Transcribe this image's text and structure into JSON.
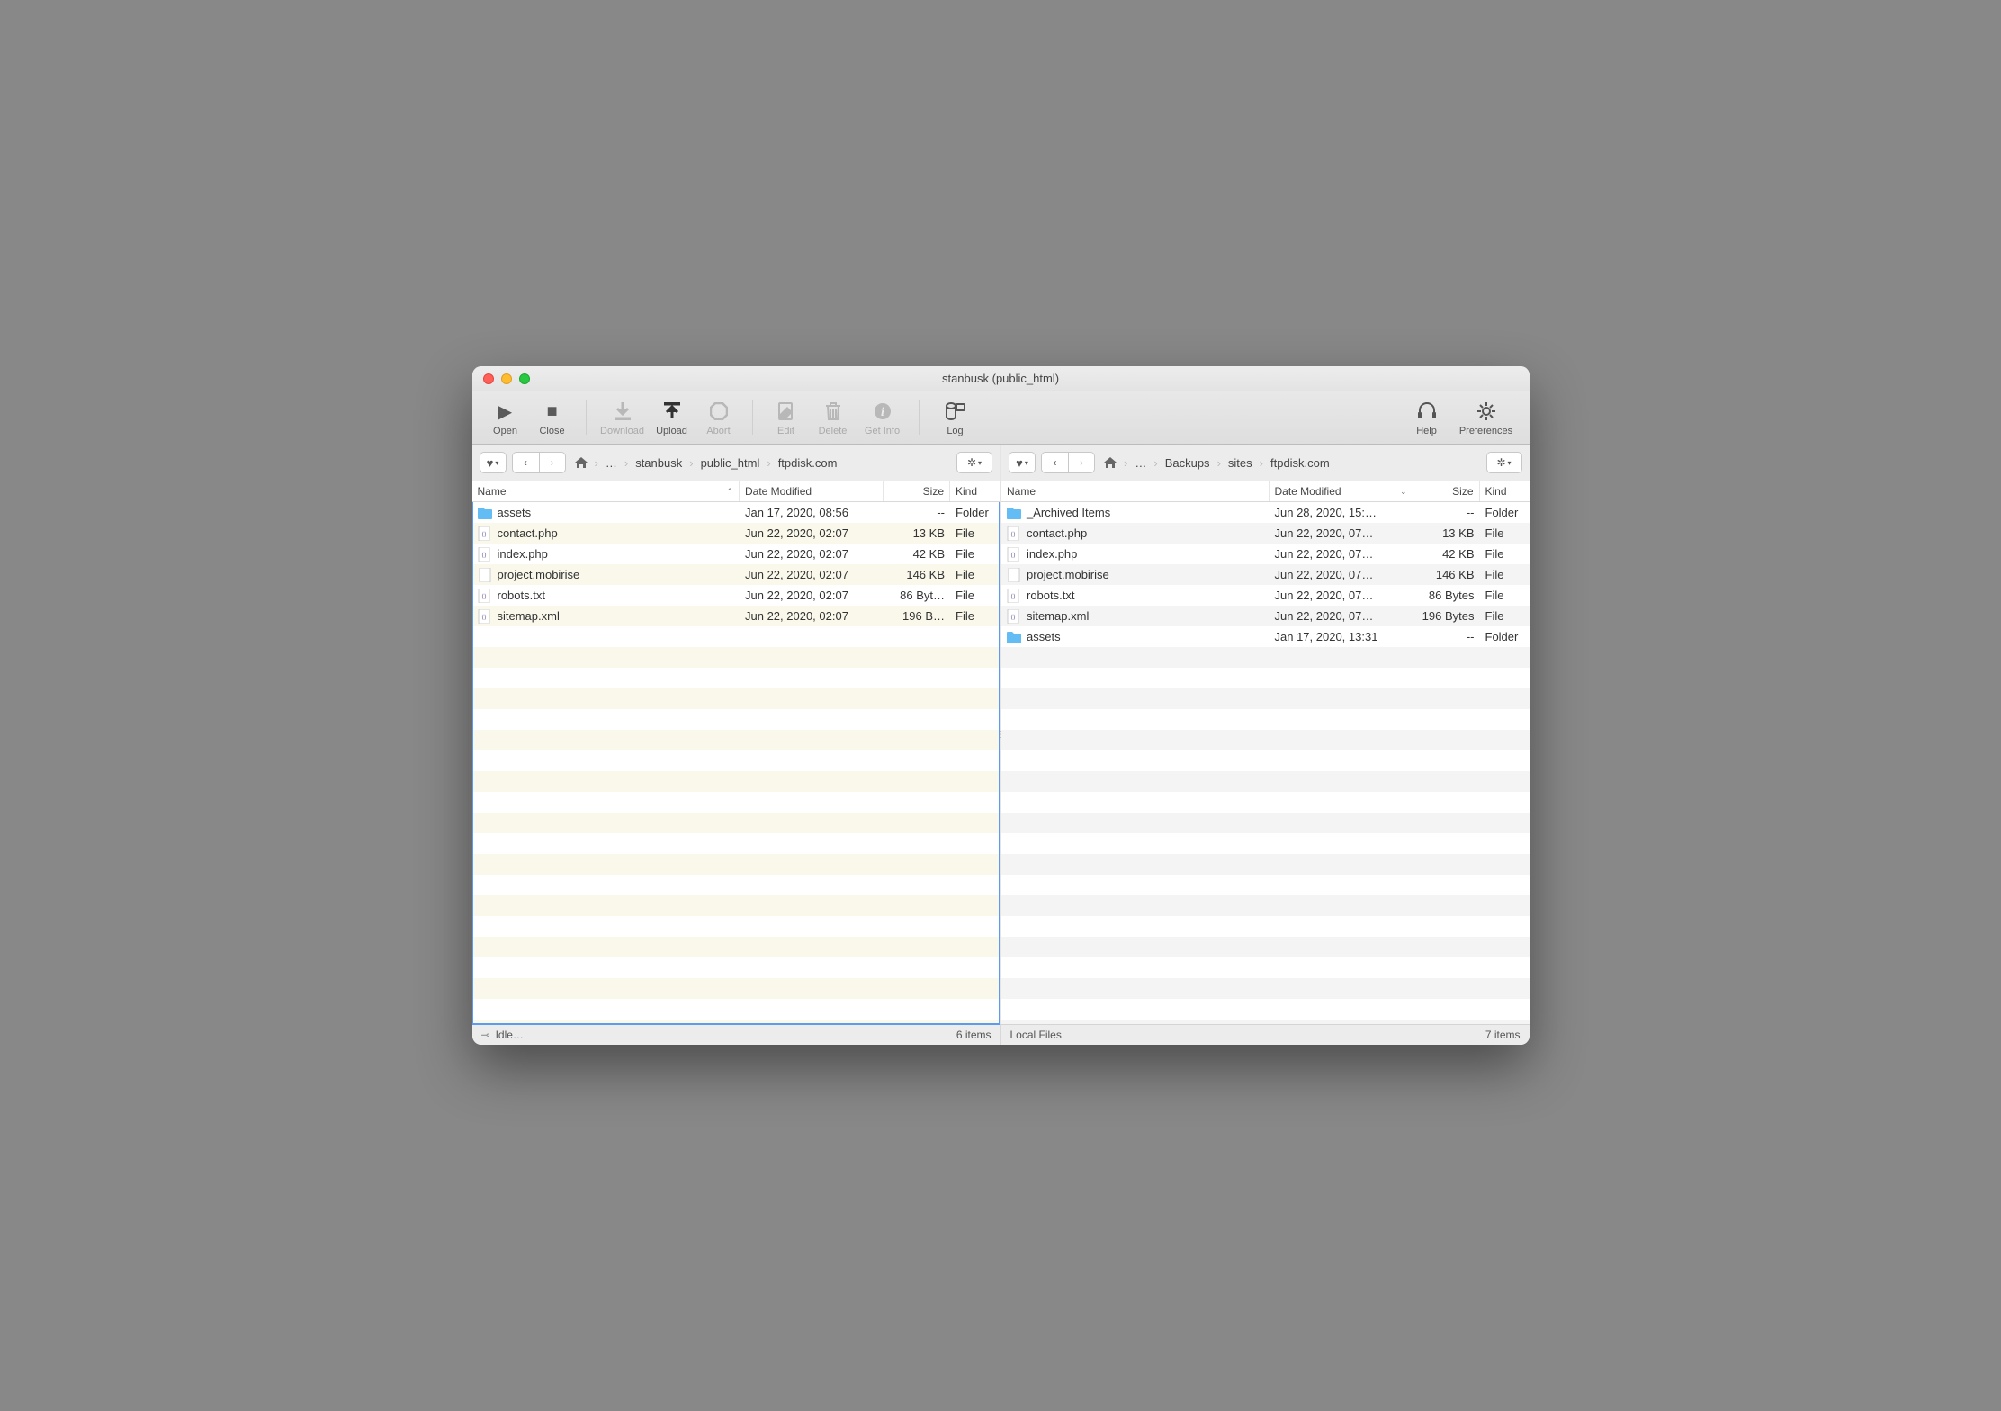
{
  "window": {
    "title": "stanbusk (public_html)"
  },
  "toolbar": {
    "open": "Open",
    "close": "Close",
    "download": "Download",
    "upload": "Upload",
    "abort": "Abort",
    "edit": "Edit",
    "delete": "Delete",
    "getinfo": "Get Info",
    "log": "Log",
    "help": "Help",
    "preferences": "Preferences"
  },
  "left": {
    "breadcrumbs": [
      "…",
      "stanbusk",
      "public_html",
      "ftpdisk.com"
    ],
    "columns": {
      "name": "Name",
      "date": "Date Modified",
      "size": "Size",
      "kind": "Kind"
    },
    "sort": {
      "column": "name",
      "asc": true
    },
    "items": [
      {
        "icon": "folder",
        "name": "assets",
        "date": "Jan 17, 2020, 08:56",
        "size": "--",
        "kind": "Folder"
      },
      {
        "icon": "php",
        "name": "contact.php",
        "date": "Jun 22, 2020, 02:07",
        "size": "13 KB",
        "kind": "File"
      },
      {
        "icon": "php",
        "name": "index.php",
        "date": "Jun 22, 2020, 02:07",
        "size": "42 KB",
        "kind": "File"
      },
      {
        "icon": "file",
        "name": "project.mobirise",
        "date": "Jun 22, 2020, 02:07",
        "size": "146 KB",
        "kind": "File"
      },
      {
        "icon": "php",
        "name": "robots.txt",
        "date": "Jun 22, 2020, 02:07",
        "size": "86 Byt…",
        "kind": "File"
      },
      {
        "icon": "php",
        "name": "sitemap.xml",
        "date": "Jun 22, 2020, 02:07",
        "size": "196 B…",
        "kind": "File"
      }
    ],
    "status_left": "Idle…",
    "status_right": "6 items"
  },
  "right": {
    "breadcrumbs": [
      "…",
      "Backups",
      "sites",
      "ftpdisk.com"
    ],
    "columns": {
      "name": "Name",
      "date": "Date Modified",
      "size": "Size",
      "kind": "Kind"
    },
    "sort": {
      "column": "date",
      "asc": false
    },
    "items": [
      {
        "icon": "folder",
        "name": "_Archived Items",
        "date": "Jun 28, 2020, 15:…",
        "size": "--",
        "kind": "Folder"
      },
      {
        "icon": "php",
        "name": "contact.php",
        "date": "Jun 22, 2020, 07…",
        "size": "13 KB",
        "kind": "File"
      },
      {
        "icon": "php",
        "name": "index.php",
        "date": "Jun 22, 2020, 07…",
        "size": "42 KB",
        "kind": "File"
      },
      {
        "icon": "file",
        "name": "project.mobirise",
        "date": "Jun 22, 2020, 07…",
        "size": "146 KB",
        "kind": "File"
      },
      {
        "icon": "php",
        "name": "robots.txt",
        "date": "Jun 22, 2020, 07…",
        "size": "86 Bytes",
        "kind": "File"
      },
      {
        "icon": "php",
        "name": "sitemap.xml",
        "date": "Jun 22, 2020, 07…",
        "size": "196 Bytes",
        "kind": "File"
      },
      {
        "icon": "folder",
        "name": "assets",
        "date": "Jan 17, 2020, 13:31",
        "size": "--",
        "kind": "Folder"
      }
    ],
    "status_left": "Local Files",
    "status_right": "7 items"
  }
}
